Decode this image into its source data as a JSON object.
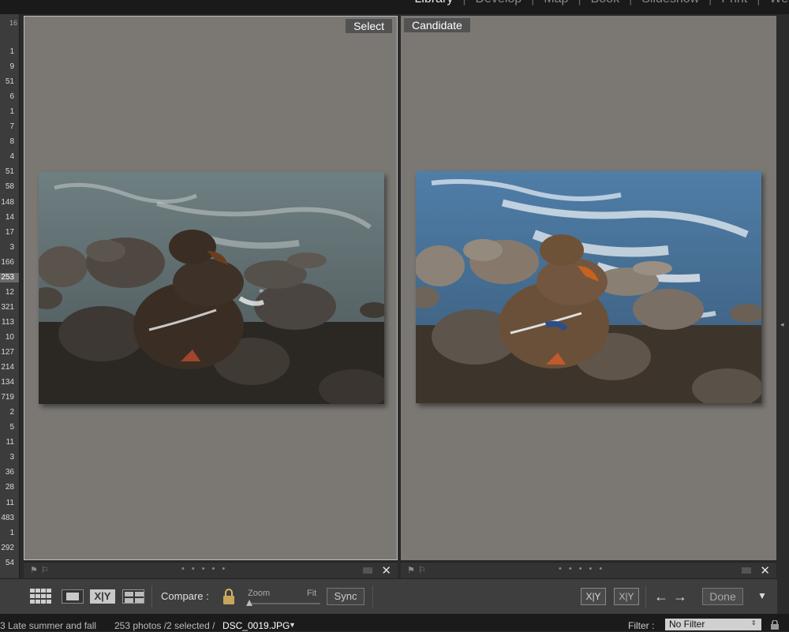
{
  "modules": [
    "Library",
    "Develop",
    "Map",
    "Book",
    "Slideshow",
    "Print",
    "Web"
  ],
  "active_module": "Library",
  "left_panel": {
    "header": "16",
    "counts": [
      "1",
      "9",
      "51",
      "6",
      "1",
      "7",
      "8",
      "4",
      "51",
      "58",
      "148",
      "14",
      "17",
      "3",
      "166",
      "253",
      "12",
      "321",
      "113",
      "10",
      "127",
      "214",
      "134",
      "719",
      "2",
      "5",
      "11",
      "3",
      "36",
      "28",
      "11",
      "483",
      "1",
      "292",
      "54"
    ],
    "selected_index": 15
  },
  "panes": {
    "select_label": "Select",
    "candidate_label": "Candidate"
  },
  "toolbar": {
    "compare_label": "Compare :",
    "zoom_label": "Zoom",
    "fit_label": "Fit",
    "sync_label": "Sync",
    "compare_view_label": "X|Y",
    "swap_label": "X|Y",
    "make_select_label": "X|Y",
    "done_label": "Done"
  },
  "status": {
    "folder": "3 Late summer and fall",
    "photo_count": "253 photos /2 selected /",
    "file_name": "DSC_0019.JPG",
    "filter_label": "Filter :",
    "filter_value": "No Filter"
  },
  "colors": {
    "pane_background": "#7b7874",
    "toolbar_background": "#3e3e3e",
    "status_background": "#1b1b1b"
  }
}
